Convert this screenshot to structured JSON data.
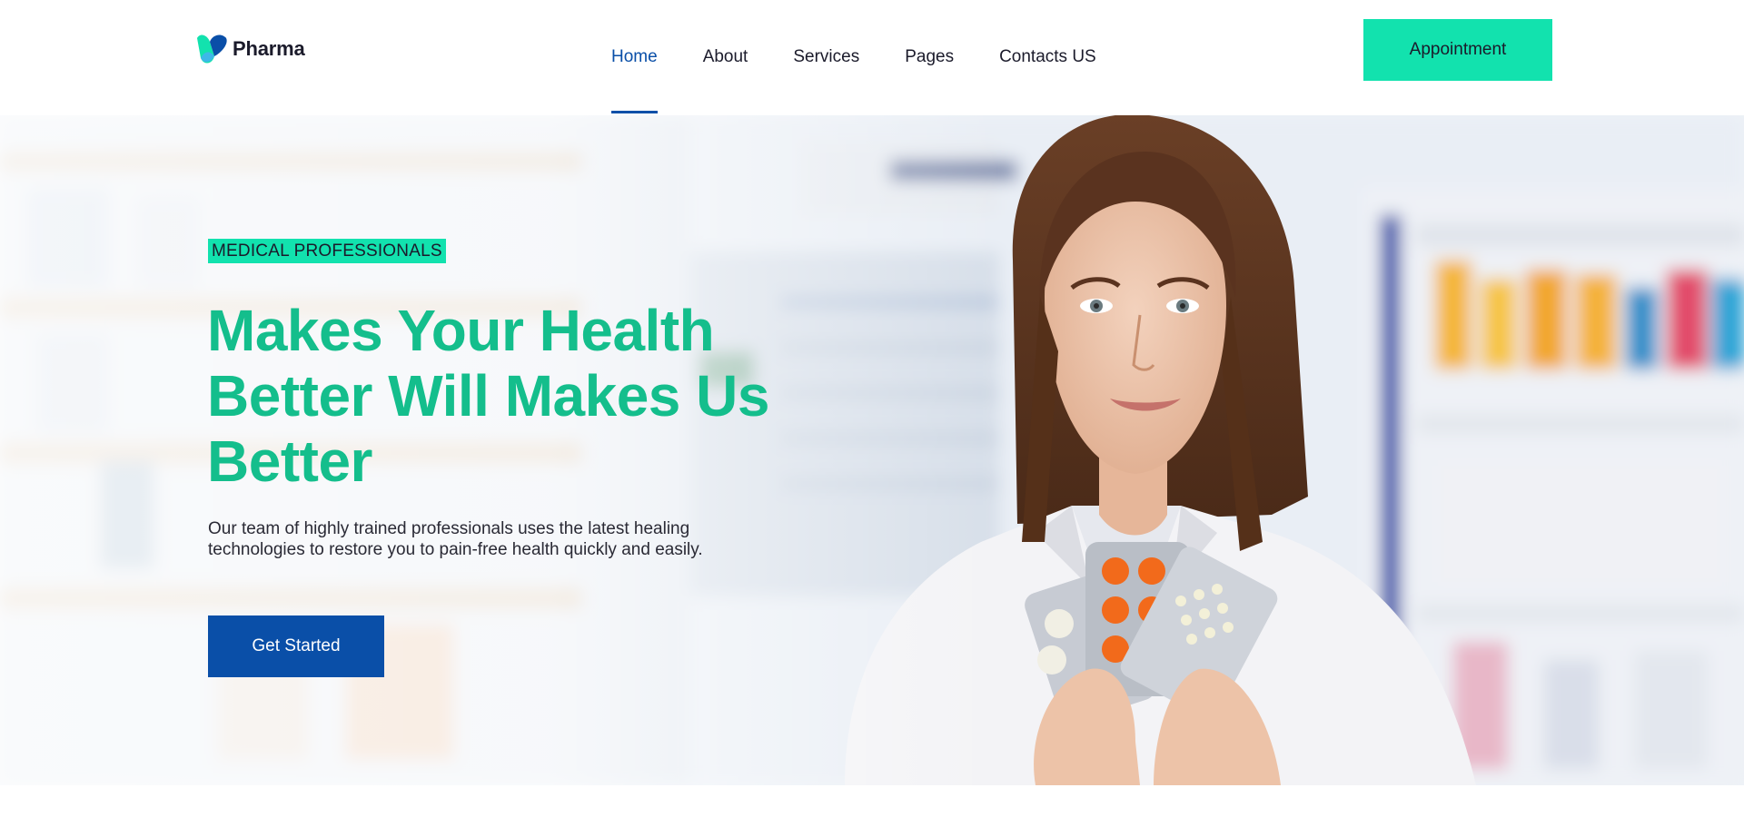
{
  "brand": {
    "name": "Pharma",
    "logo_icon": "heart-drop-logo-icon",
    "colors": {
      "primary_blue": "#0a4fa8",
      "accent_green": "#12e2ae",
      "heading_green": "#14be8c",
      "text_dark": "#1b1b2b"
    }
  },
  "nav": {
    "items": [
      {
        "label": "Home",
        "active": true
      },
      {
        "label": "About",
        "active": false
      },
      {
        "label": "Services",
        "active": false
      },
      {
        "label": "Pages",
        "active": false
      },
      {
        "label": "Contacts US",
        "active": false
      }
    ],
    "cta_label": "Appointment"
  },
  "hero": {
    "eyebrow": "MEDICAL PROFESSIONALS",
    "title": "Makes Your Health Better Will Makes Us Better",
    "description": "Our team of highly trained professionals uses the latest healing technologies to restore you to pain-free health quickly and easily.",
    "cta_label": "Get Started",
    "image": "pharmacist-holding-pill-blister-packs-photo"
  }
}
